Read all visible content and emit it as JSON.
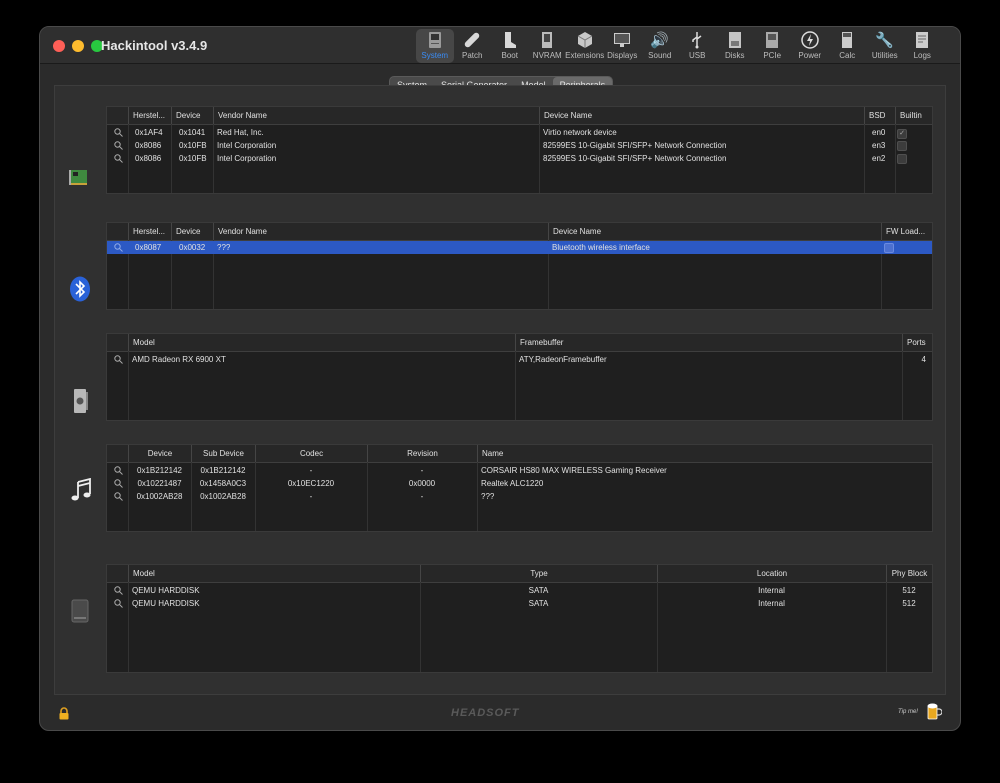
{
  "window": {
    "title": "Hackintool v3.4.9"
  },
  "toolbar": [
    {
      "label": "System",
      "icon": "system-icon",
      "active": true
    },
    {
      "label": "Patch",
      "icon": "patch-icon"
    },
    {
      "label": "Boot",
      "icon": "boot-icon"
    },
    {
      "label": "NVRAM",
      "icon": "nvram-icon"
    },
    {
      "label": "Extensions",
      "icon": "extensions-icon"
    },
    {
      "label": "Displays",
      "icon": "displays-icon"
    },
    {
      "label": "Sound",
      "icon": "sound-icon"
    },
    {
      "label": "USB",
      "icon": "usb-icon"
    },
    {
      "label": "Disks",
      "icon": "disks-icon"
    },
    {
      "label": "PCIe",
      "icon": "pcie-icon"
    },
    {
      "label": "Power",
      "icon": "power-icon"
    },
    {
      "label": "Calc",
      "icon": "calc-icon"
    },
    {
      "label": "Utilities",
      "icon": "utilities-icon"
    },
    {
      "label": "Logs",
      "icon": "logs-icon"
    }
  ],
  "tabs": [
    {
      "label": "System"
    },
    {
      "label": "Serial Generator"
    },
    {
      "label": "Model"
    },
    {
      "label": "Peripherals",
      "active": true
    }
  ],
  "network": {
    "headers": [
      "Herstel...",
      "Device",
      "Vendor Name",
      "Device Name",
      "BSD",
      "Builtin"
    ],
    "rows": [
      [
        "0x1AF4",
        "0x1041",
        "Red Hat, Inc.",
        "Virtio network device",
        "en0",
        "✓"
      ],
      [
        "0x8086",
        "0x10FB",
        "Intel Corporation",
        "82599ES 10-Gigabit SFI/SFP+ Network Connection",
        "en3",
        ""
      ],
      [
        "0x8086",
        "0x10FB",
        "Intel Corporation",
        "82599ES 10-Gigabit SFI/SFP+ Network Connection",
        "en2",
        ""
      ]
    ]
  },
  "bluetooth": {
    "headers": [
      "Herstel...",
      "Device",
      "Vendor Name",
      "Device Name",
      "FW Load..."
    ],
    "rows": [
      [
        "0x8087",
        "0x0032",
        "???",
        "Bluetooth wireless interface",
        ""
      ]
    ]
  },
  "graphics": {
    "headers": [
      "Model",
      "Framebuffer",
      "Ports"
    ],
    "rows": [
      [
        "AMD Radeon RX 6900 XT",
        "ATY,RadeonFramebuffer",
        "4"
      ]
    ]
  },
  "audio": {
    "headers": [
      "Device",
      "Sub Device",
      "Codec",
      "Revision",
      "Name"
    ],
    "rows": [
      [
        "0x1B212142",
        "0x1B212142",
        "-",
        "-",
        "CORSAIR HS80 MAX WIRELESS Gaming Receiver"
      ],
      [
        "0x10221487",
        "0x1458A0C3",
        "0x10EC1220",
        "0x0000",
        "Realtek ALC1220"
      ],
      [
        "0x1002AB28",
        "0x1002AB28",
        "-",
        "-",
        "???"
      ]
    ]
  },
  "storage": {
    "headers": [
      "Model",
      "Type",
      "Location",
      "Phy Block"
    ],
    "rows": [
      [
        "QEMU HARDDISK",
        "SATA",
        "Internal",
        "512"
      ],
      [
        "QEMU HARDDISK",
        "SATA",
        "Internal",
        "512"
      ]
    ]
  },
  "footer": {
    "brand": "HEADSOFT",
    "tip": "Tip me!"
  },
  "colors": {
    "accent": "#2c59c4",
    "toolbar_active": "#3a8cf5"
  }
}
